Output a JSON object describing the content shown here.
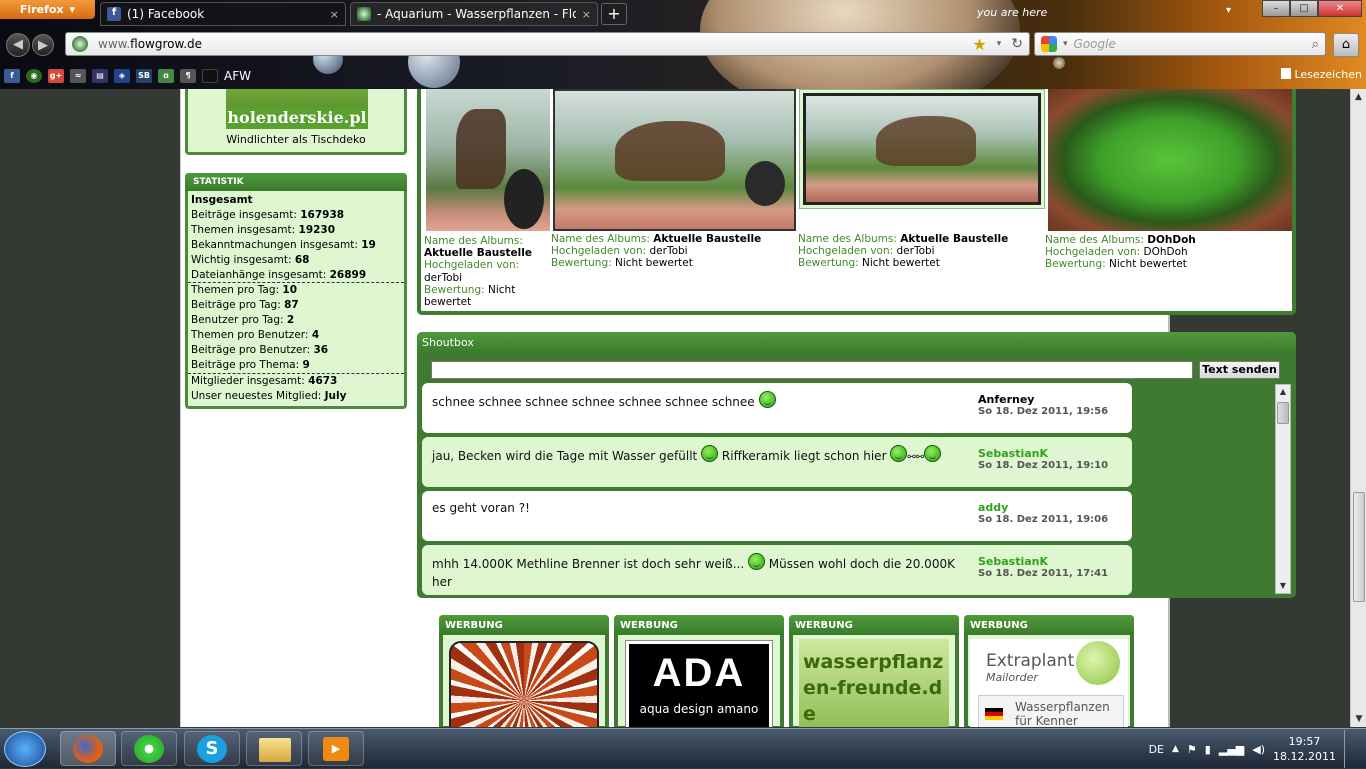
{
  "browser": {
    "menu_label": "Firefox",
    "tabs": [
      {
        "label": "(1) Facebook",
        "close": "×"
      },
      {
        "label": "- Aquarium - Wasserpflanzen - Flowg...",
        "close": "×"
      }
    ],
    "newtab": "+",
    "window_controls": {
      "min": "–",
      "max": "□",
      "close": "✕"
    },
    "you_are_here": "you are here",
    "url_scheme": "www.",
    "url_host": "flowgrow.de",
    "search_placeholder": "Google",
    "bookmarks": [
      {
        "icon": "facebook-icon",
        "color": "#3b5998",
        "text": "f"
      },
      {
        "icon": "flowgrow-icon",
        "color": "#2a6a1a",
        "text": "◉"
      },
      {
        "icon": "googleplus-icon",
        "color": "#d34836",
        "text": "g+"
      },
      {
        "icon": "bookmark-icon-4",
        "color": "#555",
        "text": "≈"
      },
      {
        "icon": "bookmark-icon-5",
        "color": "#336",
        "text": "▤"
      },
      {
        "icon": "bookmark-icon-6",
        "color": "#248",
        "text": "◈"
      },
      {
        "icon": "bookmark-icon-7",
        "color": "#246",
        "text": "SB"
      },
      {
        "icon": "bookmark-icon-8",
        "color": "#484",
        "text": "ɑ"
      },
      {
        "icon": "bookmark-icon-9",
        "color": "#555",
        "text": "¶"
      },
      {
        "icon": "bookmark-icon-10",
        "color": "#111",
        "text": ""
      }
    ],
    "bookmark_text": "AFW",
    "bookmarks_label": "Lesezeichen"
  },
  "sidebar": {
    "holenderskie": {
      "banner_text": "holenderskie.pl",
      "caption": "Windlichter als Tischdeko"
    },
    "statistik": {
      "title": "STATISTIK",
      "heading": "Insgesamt",
      "rows": [
        {
          "label": "Beiträge insgesamt:",
          "value": "167938"
        },
        {
          "label": "Themen insgesamt:",
          "value": "19230"
        },
        {
          "label": "Bekanntmachungen insgesamt:",
          "value": "19"
        },
        {
          "label": "Wichtig insgesamt:",
          "value": "68"
        },
        {
          "label": "Dateianhänge insgesamt:",
          "value": "26899"
        },
        {
          "label": "Themen pro Tag:",
          "value": "10"
        },
        {
          "label": "Beiträge pro Tag:",
          "value": "87"
        },
        {
          "label": "Benutzer pro Tag:",
          "value": "2"
        },
        {
          "label": "Themen pro Benutzer:",
          "value": "4"
        },
        {
          "label": "Beiträge pro Benutzer:",
          "value": "36"
        },
        {
          "label": "Beiträge pro Thema:",
          "value": "9"
        },
        {
          "label": "Mitglieder insgesamt:",
          "value": "4673"
        },
        {
          "label": "Unser neuestes Mitglied:",
          "value": "July"
        }
      ]
    }
  },
  "gallery": {
    "labels": {
      "album": "Name des Albums:",
      "uploaded": "Hochgeladen von:",
      "rating": "Bewertung:"
    },
    "items": [
      {
        "album": "Aktuelle Baustelle",
        "uploader": "derTobi",
        "rating": "Nicht bewertet"
      },
      {
        "album": "Aktuelle Baustelle",
        "uploader": "derTobi",
        "rating": "Nicht bewertet"
      },
      {
        "album": "Aktuelle Baustelle",
        "uploader": "derTobi",
        "rating": "Nicht bewertet"
      },
      {
        "album": "DOhDoh",
        "uploader": "DOhDoh",
        "rating": "Nicht bewertet"
      }
    ]
  },
  "shoutbox": {
    "title": "Shoutbox",
    "send_label": "Text senden",
    "messages": [
      {
        "text_a": "schnee schnee schnee schnee schnee schnee schnee",
        "text_b": "",
        "author": "Anferney",
        "date": "So 18. Dez 2011, 19:56"
      },
      {
        "text_a": "jau, Becken wird die Tage mit Wasser gefüllt",
        "text_b": "Riffkeramik liegt schon hier",
        "author": "SebastianK",
        "date": "So 18. Dez 2011, 19:10"
      },
      {
        "text_a": "es geht voran ?!",
        "text_b": "",
        "author": "addy",
        "date": "So 18. Dez 2011, 19:06"
      },
      {
        "text_a": "mhh 14.000K Methline Brenner ist doch sehr weiß...",
        "text_b": "Müssen wohl doch die 20.000K her",
        "author": "SebastianK",
        "date": "So 18. Dez 2011, 17:41"
      }
    ]
  },
  "ads": {
    "heading": "WERBUNG",
    "ada_logo": "ADA",
    "ada_text": "aqua design amano",
    "wpf_text": "wasserpflanzen-freunde.de",
    "extraplant": "Extraplant",
    "extraplant_sub": "Mailorder",
    "extraplant_tag": "Wasserpflanzen für Kenner"
  },
  "taskbar": {
    "lang": "DE",
    "time": "19:57",
    "date": "18.12.2011"
  },
  "colors": {
    "green_dark": "#3f7a31",
    "green_light": "#dff7d0",
    "author_green": "#33a020"
  }
}
